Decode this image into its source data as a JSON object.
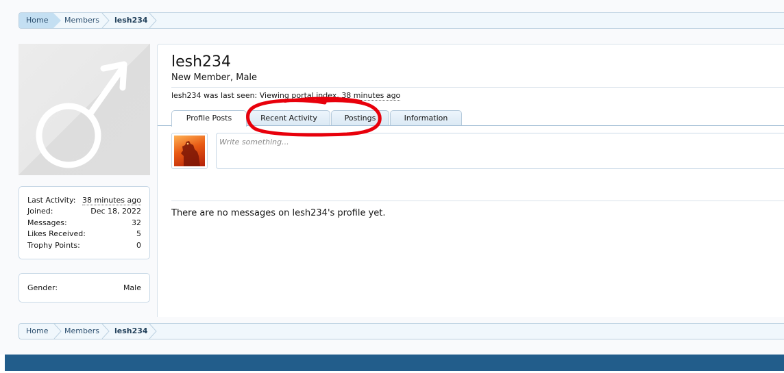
{
  "breadcrumb": {
    "home": "Home",
    "members": "Members",
    "current": "lesh234"
  },
  "profile": {
    "username": "lesh234",
    "user_title": "New Member, Male",
    "last_seen_prefix": "lesh234 was last seen:",
    "last_seen_activity": "Viewing portal index,",
    "last_seen_time": "38 minutes ago"
  },
  "stats": {
    "last_activity_label": "Last Activity:",
    "last_activity_value": "38 minutes ago",
    "joined_label": "Joined:",
    "joined_value": "Dec 18, 2022",
    "messages_label": "Messages:",
    "messages_value": "32",
    "likes_label": "Likes Received:",
    "likes_value": "5",
    "trophy_label": "Trophy Points:",
    "trophy_value": "0"
  },
  "info": {
    "gender_label": "Gender:",
    "gender_value": "Male"
  },
  "tabs": [
    {
      "label": "Profile Posts"
    },
    {
      "label": "Recent Activity"
    },
    {
      "label": "Postings"
    },
    {
      "label": "Information"
    }
  ],
  "composer": {
    "placeholder": "Write something..."
  },
  "empty_message": "There are no messages on lesh234's profile yet.",
  "icons": {
    "default_avatar": "male-symbol-icon",
    "user_avatar": "godzilla-avatar-icon",
    "annotation": "red-circle-annotation"
  },
  "colors": {
    "breadcrumb_active": "#c4dff2",
    "tab_border": "#b5cadb",
    "footer": "#225d8b",
    "annotation": "#e8000b"
  }
}
